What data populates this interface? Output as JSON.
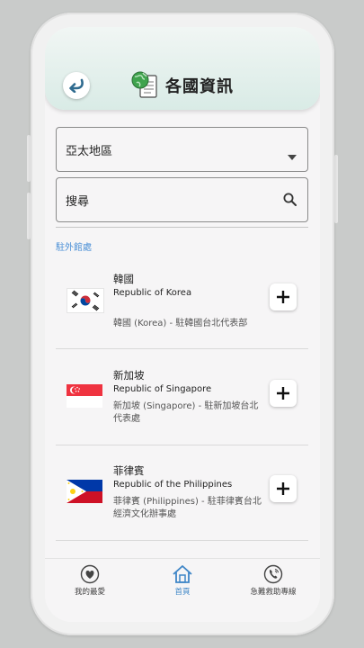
{
  "header": {
    "title": "各國資訊",
    "back_icon": "back-arrow-icon",
    "title_icon": "globe-document-icon"
  },
  "region_select": {
    "value": "亞太地區"
  },
  "search": {
    "placeholder": "搜尋"
  },
  "section_label": "駐外館處",
  "countries": [
    {
      "name_zh": "韓國",
      "name_en": "Republic of Korea",
      "description": "韓國 (Korea) - 駐韓國台北代表部",
      "flag": "korea-flag"
    },
    {
      "name_zh": "新加坡",
      "name_en": "Republic of Singapore",
      "description": "新加坡 (Singapore) - 駐新加坡台北代表處",
      "flag": "singapore-flag"
    },
    {
      "name_zh": "菲律賓",
      "name_en": "Republic of the Philippines",
      "description": "菲律賓 (Philippines) - 駐菲律賓台北經濟文化辦事處",
      "flag": "philippines-flag"
    }
  ],
  "nav": {
    "favorites": "我的最愛",
    "home": "首頁",
    "emergency": "急難救助專線"
  },
  "colors": {
    "accent": "#4a8fd6",
    "header_bg": "#d9ebe6",
    "back_arrow": "#2f6b8f"
  }
}
